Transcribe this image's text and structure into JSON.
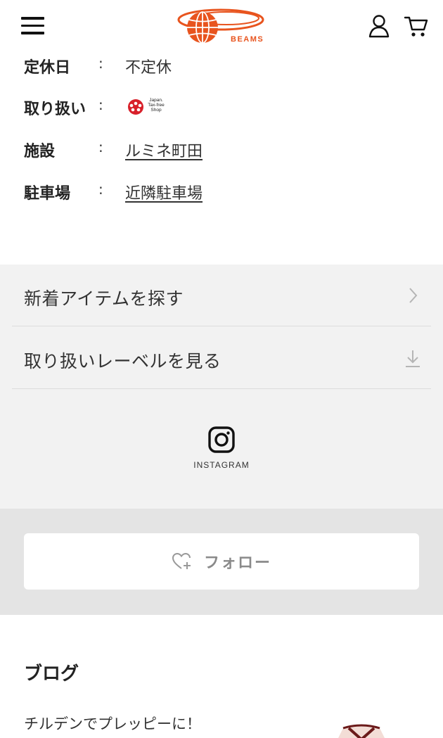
{
  "header": {
    "brand": "BEAMS",
    "menu_icon": "hamburger-icon",
    "user_icon": "user-icon",
    "cart_icon": "cart-icon"
  },
  "store_info": {
    "rows": [
      {
        "label": "定休日",
        "colon": ":",
        "value": "不定休"
      },
      {
        "label": "取り扱い",
        "colon": ":",
        "value_icon": "japan-tax-free-shop-icon",
        "tax_free_text": "Japan. Tax-free Shop"
      },
      {
        "label": "施設",
        "colon": ":",
        "value": "ルミネ町田"
      },
      {
        "label": "駐車場",
        "colon": ":",
        "value": "近隣駐車場"
      }
    ]
  },
  "links": {
    "new_items": "新着アイテムを探す",
    "labels": "取り扱いレーベルを見る",
    "instagram": "INSTAGRAM"
  },
  "follow": {
    "label": "フォロー",
    "icon": "heart-plus-icon"
  },
  "blog": {
    "title": "ブログ",
    "items": [
      {
        "title": "チルデンでプレッピーに！"
      }
    ]
  },
  "colors": {
    "brand": "#e8541e",
    "gray_section": "#f2f2f2",
    "follow_band": "#e4e4e4"
  }
}
